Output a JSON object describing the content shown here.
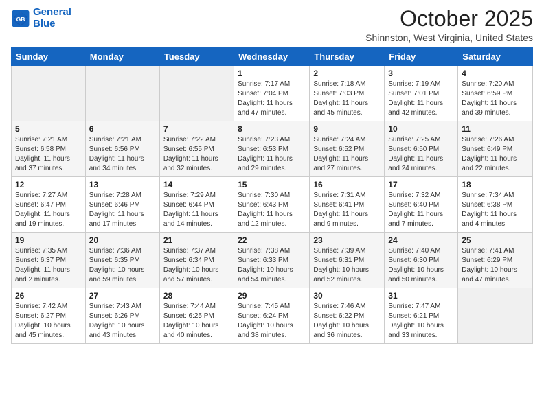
{
  "logo": {
    "line1": "General",
    "line2": "Blue"
  },
  "title": "October 2025",
  "location": "Shinnston, West Virginia, United States",
  "days_of_week": [
    "Sunday",
    "Monday",
    "Tuesday",
    "Wednesday",
    "Thursday",
    "Friday",
    "Saturday"
  ],
  "weeks": [
    [
      {
        "day": "",
        "info": ""
      },
      {
        "day": "",
        "info": ""
      },
      {
        "day": "",
        "info": ""
      },
      {
        "day": "1",
        "info": "Sunrise: 7:17 AM\nSunset: 7:04 PM\nDaylight: 11 hours\nand 47 minutes."
      },
      {
        "day": "2",
        "info": "Sunrise: 7:18 AM\nSunset: 7:03 PM\nDaylight: 11 hours\nand 45 minutes."
      },
      {
        "day": "3",
        "info": "Sunrise: 7:19 AM\nSunset: 7:01 PM\nDaylight: 11 hours\nand 42 minutes."
      },
      {
        "day": "4",
        "info": "Sunrise: 7:20 AM\nSunset: 6:59 PM\nDaylight: 11 hours\nand 39 minutes."
      }
    ],
    [
      {
        "day": "5",
        "info": "Sunrise: 7:21 AM\nSunset: 6:58 PM\nDaylight: 11 hours\nand 37 minutes."
      },
      {
        "day": "6",
        "info": "Sunrise: 7:21 AM\nSunset: 6:56 PM\nDaylight: 11 hours\nand 34 minutes."
      },
      {
        "day": "7",
        "info": "Sunrise: 7:22 AM\nSunset: 6:55 PM\nDaylight: 11 hours\nand 32 minutes."
      },
      {
        "day": "8",
        "info": "Sunrise: 7:23 AM\nSunset: 6:53 PM\nDaylight: 11 hours\nand 29 minutes."
      },
      {
        "day": "9",
        "info": "Sunrise: 7:24 AM\nSunset: 6:52 PM\nDaylight: 11 hours\nand 27 minutes."
      },
      {
        "day": "10",
        "info": "Sunrise: 7:25 AM\nSunset: 6:50 PM\nDaylight: 11 hours\nand 24 minutes."
      },
      {
        "day": "11",
        "info": "Sunrise: 7:26 AM\nSunset: 6:49 PM\nDaylight: 11 hours\nand 22 minutes."
      }
    ],
    [
      {
        "day": "12",
        "info": "Sunrise: 7:27 AM\nSunset: 6:47 PM\nDaylight: 11 hours\nand 19 minutes."
      },
      {
        "day": "13",
        "info": "Sunrise: 7:28 AM\nSunset: 6:46 PM\nDaylight: 11 hours\nand 17 minutes."
      },
      {
        "day": "14",
        "info": "Sunrise: 7:29 AM\nSunset: 6:44 PM\nDaylight: 11 hours\nand 14 minutes."
      },
      {
        "day": "15",
        "info": "Sunrise: 7:30 AM\nSunset: 6:43 PM\nDaylight: 11 hours\nand 12 minutes."
      },
      {
        "day": "16",
        "info": "Sunrise: 7:31 AM\nSunset: 6:41 PM\nDaylight: 11 hours\nand 9 minutes."
      },
      {
        "day": "17",
        "info": "Sunrise: 7:32 AM\nSunset: 6:40 PM\nDaylight: 11 hours\nand 7 minutes."
      },
      {
        "day": "18",
        "info": "Sunrise: 7:34 AM\nSunset: 6:38 PM\nDaylight: 11 hours\nand 4 minutes."
      }
    ],
    [
      {
        "day": "19",
        "info": "Sunrise: 7:35 AM\nSunset: 6:37 PM\nDaylight: 11 hours\nand 2 minutes."
      },
      {
        "day": "20",
        "info": "Sunrise: 7:36 AM\nSunset: 6:35 PM\nDaylight: 10 hours\nand 59 minutes."
      },
      {
        "day": "21",
        "info": "Sunrise: 7:37 AM\nSunset: 6:34 PM\nDaylight: 10 hours\nand 57 minutes."
      },
      {
        "day": "22",
        "info": "Sunrise: 7:38 AM\nSunset: 6:33 PM\nDaylight: 10 hours\nand 54 minutes."
      },
      {
        "day": "23",
        "info": "Sunrise: 7:39 AM\nSunset: 6:31 PM\nDaylight: 10 hours\nand 52 minutes."
      },
      {
        "day": "24",
        "info": "Sunrise: 7:40 AM\nSunset: 6:30 PM\nDaylight: 10 hours\nand 50 minutes."
      },
      {
        "day": "25",
        "info": "Sunrise: 7:41 AM\nSunset: 6:29 PM\nDaylight: 10 hours\nand 47 minutes."
      }
    ],
    [
      {
        "day": "26",
        "info": "Sunrise: 7:42 AM\nSunset: 6:27 PM\nDaylight: 10 hours\nand 45 minutes."
      },
      {
        "day": "27",
        "info": "Sunrise: 7:43 AM\nSunset: 6:26 PM\nDaylight: 10 hours\nand 43 minutes."
      },
      {
        "day": "28",
        "info": "Sunrise: 7:44 AM\nSunset: 6:25 PM\nDaylight: 10 hours\nand 40 minutes."
      },
      {
        "day": "29",
        "info": "Sunrise: 7:45 AM\nSunset: 6:24 PM\nDaylight: 10 hours\nand 38 minutes."
      },
      {
        "day": "30",
        "info": "Sunrise: 7:46 AM\nSunset: 6:22 PM\nDaylight: 10 hours\nand 36 minutes."
      },
      {
        "day": "31",
        "info": "Sunrise: 7:47 AM\nSunset: 6:21 PM\nDaylight: 10 hours\nand 33 minutes."
      },
      {
        "day": "",
        "info": ""
      }
    ]
  ]
}
